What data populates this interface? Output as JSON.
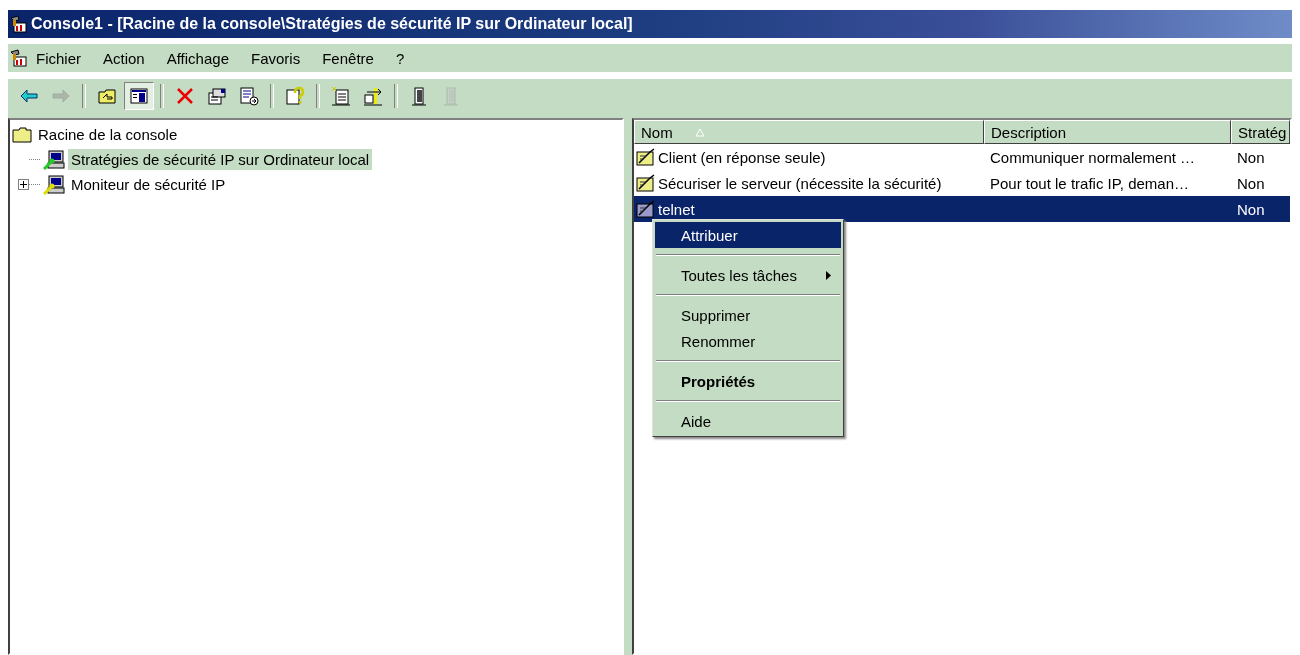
{
  "window": {
    "title": "Console1 - [Racine de la console\\Stratégies de sécurité IP sur Ordinateur local]"
  },
  "menu_bar": [
    "Fichier",
    "Action",
    "Affichage",
    "Favoris",
    "Fenêtre",
    "?"
  ],
  "toolbar": [
    [
      {
        "disabled": false,
        "pressed": false
      },
      {
        "disabled": true,
        "pressed": false
      }
    ],
    [
      {
        "disabled": false,
        "pressed": false
      },
      {
        "disabled": false,
        "pressed": true
      }
    ],
    [
      {
        "disabled": false,
        "pressed": false
      },
      {
        "disabled": false,
        "pressed": false
      },
      {
        "disabled": false,
        "pressed": false
      }
    ],
    [
      {
        "disabled": false,
        "pressed": false
      }
    ],
    [
      {
        "disabled": false,
        "pressed": false
      },
      {
        "disabled": false,
        "pressed": false
      }
    ],
    [
      {
        "disabled": false,
        "pressed": false
      },
      {
        "disabled": true,
        "pressed": false
      }
    ]
  ],
  "tree": [
    {
      "label": "Racine de la console",
      "selected": false,
      "children": [
        {
          "label": "Stratégies de sécurité IP sur Ordinateur local",
          "selected": true,
          "expandable": false
        },
        {
          "label": "Moniteur de sécurité IP",
          "selected": false,
          "expandable": true,
          "expanded": false
        }
      ]
    }
  ],
  "list": {
    "columns": [
      {
        "label": "Nom",
        "sorted": true
      },
      {
        "label": "Description"
      },
      {
        "label": "Stratég"
      }
    ],
    "rows": [
      {
        "name": "Client (en réponse seule)",
        "description": "Communiquer normalement …",
        "assigned": "Non",
        "selected": false
      },
      {
        "name": "Sécuriser le serveur (nécessite la sécurité)",
        "description": "Pour tout le trafic IP, deman…",
        "assigned": "Non",
        "selected": false
      },
      {
        "name": "telnet",
        "description": "",
        "assigned": "Non",
        "selected": true
      }
    ]
  },
  "context_menu": [
    {
      "kind": "item",
      "label": "Attribuer",
      "selected": true,
      "bold": false,
      "submenu": false
    },
    {
      "kind": "separator"
    },
    {
      "kind": "item",
      "label": "Toutes les tâches",
      "selected": false,
      "bold": false,
      "submenu": true
    },
    {
      "kind": "separator"
    },
    {
      "kind": "item",
      "label": "Supprimer",
      "selected": false,
      "bold": false,
      "submenu": false
    },
    {
      "kind": "item",
      "label": "Renommer",
      "selected": false,
      "bold": false,
      "submenu": false
    },
    {
      "kind": "separator"
    },
    {
      "kind": "item",
      "label": "Propriétés",
      "selected": false,
      "bold": true,
      "submenu": false
    },
    {
      "kind": "separator"
    },
    {
      "kind": "item",
      "label": "Aide",
      "selected": false,
      "bold": false,
      "submenu": false
    }
  ]
}
